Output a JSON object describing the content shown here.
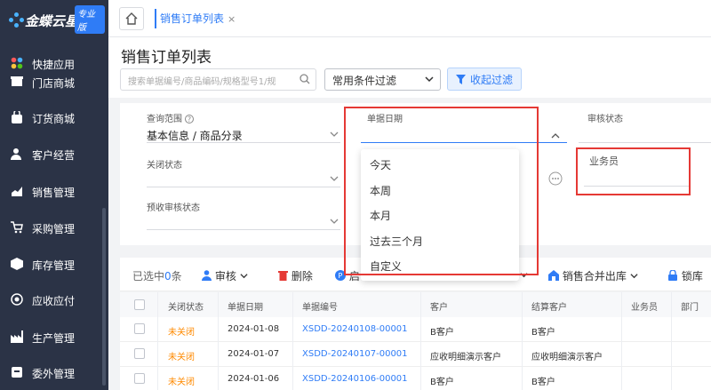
{
  "brand": {
    "name": "金蝶云星辰",
    "badge": "专业版"
  },
  "sidebar": {
    "items": [
      {
        "label": "快捷应用",
        "icon": "apps-icon"
      },
      {
        "label": "门店商城",
        "icon": "store-icon"
      },
      {
        "label": "订货商城",
        "icon": "bag-icon"
      },
      {
        "label": "客户经营",
        "icon": "customer-icon"
      },
      {
        "label": "销售管理",
        "icon": "sales-chart-icon"
      },
      {
        "label": "采购管理",
        "icon": "cart-icon"
      },
      {
        "label": "库存管理",
        "icon": "box-icon"
      },
      {
        "label": "应收应付",
        "icon": "payment-icon"
      },
      {
        "label": "生产管理",
        "icon": "factory-icon"
      },
      {
        "label": "委外管理",
        "icon": "outsource-icon"
      }
    ]
  },
  "tabs": {
    "active": "销售订单列表",
    "close": "×"
  },
  "page": {
    "title": "销售订单列表",
    "search_placeholder": "搜索单据编号/商品编码/规格型号1/规",
    "filter_select": "常用条件过滤",
    "collapse_label": "收起过滤"
  },
  "filters": {
    "scope_label": "查询范围",
    "scope_value": "基本信息 / 商品分录",
    "date_label": "单据日期",
    "audit_label": "审核状态",
    "close_label": "关闭状态",
    "salesman_label": "业务员",
    "prepay_label": "预收审核状态"
  },
  "date_dropdown": {
    "options": [
      "今天",
      "本周",
      "本月",
      "过去三个月",
      "自定义"
    ]
  },
  "toolbar": {
    "selected": "已选中",
    "selected_count": "0",
    "selected_unit": "条",
    "audit": "审核",
    "delete": "删除",
    "partial": "启",
    "merge_out": "销售合并出库",
    "lock": "锁库"
  },
  "table": {
    "headers": [
      "关闭状态",
      "单据日期",
      "单据编号",
      "客户",
      "结算客户",
      "业务员",
      "部门"
    ],
    "rows": [
      {
        "status": "未关闭",
        "date": "2024-01-08",
        "number": "XSDD-20240108-00001",
        "customer": "B客户",
        "settle": "B客户"
      },
      {
        "status": "未关闭",
        "date": "2024-01-07",
        "number": "XSDD-20240107-00001",
        "customer": "应收明细演示客户",
        "settle": "应收明细演示客户"
      },
      {
        "status": "未关闭",
        "date": "2024-01-06",
        "number": "XSDD-20240106-00001",
        "customer": "B客户",
        "settle": "B客户"
      }
    ]
  },
  "colors": {
    "accent": "#2f7cf6",
    "sidebar_bg": "#2b3346",
    "danger": "#e53935",
    "status_open": "#ff8a00"
  }
}
